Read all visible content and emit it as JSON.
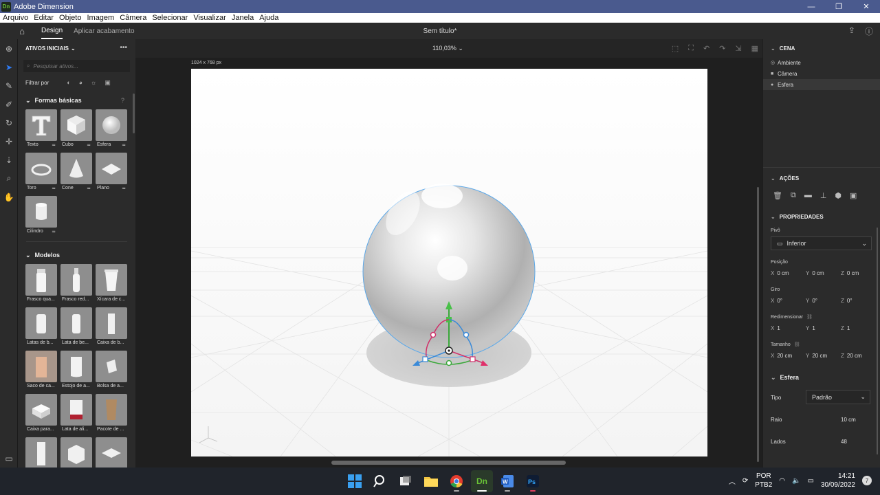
{
  "window": {
    "title": "Adobe Dimension",
    "logo": "Dn",
    "min": "—",
    "max": "❐",
    "close": "✕"
  },
  "menu": [
    "Arquivo",
    "Editar",
    "Objeto",
    "Imagem",
    "Câmera",
    "Selecionar",
    "Visualizar",
    "Janela",
    "Ajuda"
  ],
  "topbar": {
    "tabs": [
      "Design",
      "Aplicar acabamento"
    ],
    "doc_title": "Sem título*"
  },
  "assets": {
    "header": "ATIVOS INICIAIS",
    "search_placeholder": "Pesquisar ativos...",
    "filter_label": "Filtrar por",
    "basic_shapes": {
      "title": "Formas básicas",
      "items": [
        "Texto",
        "Cubo",
        "Esfera",
        "Toro",
        "Cone",
        "Plano",
        "Cilindro"
      ]
    },
    "models": {
      "title": "Modelos",
      "items": [
        "Frasco qua...",
        "Frasco red...",
        "Xícara de c...",
        "Latas de b...",
        "Lata de be...",
        "Caixa de b...",
        "Saco de ca...",
        "Estojo de a...",
        "Bolsa de a...",
        "Caixa para...",
        "Lata de ali...",
        "Pacote de ...",
        "",
        "",
        ""
      ]
    }
  },
  "canvas": {
    "zoom": "110,03%",
    "doc_size": "1024 x 768 px"
  },
  "scene": {
    "title": "CENA",
    "items": [
      "Ambiente",
      "Câmera",
      "Esfera"
    ]
  },
  "actions": {
    "title": "AÇÕES"
  },
  "properties": {
    "title": "PROPRIEDADES",
    "pivot_label": "Pivô",
    "pivot_value": "Inferior",
    "position": {
      "label": "Posição",
      "x": "0 cm",
      "y": "0 cm",
      "z": "0 cm"
    },
    "rotation": {
      "label": "Giro",
      "x": "0°",
      "y": "0°",
      "z": "0°"
    },
    "scale": {
      "label": "Redimensionar",
      "x": "1",
      "y": "1",
      "z": "1"
    },
    "size": {
      "label": "Tamanho",
      "x": "20 cm",
      "y": "20 cm",
      "z": "20 cm"
    }
  },
  "sphere": {
    "title": "Esfera",
    "type_label": "Tipo",
    "type_value": "Padrão",
    "radius_label": "Raio",
    "radius_value": "10 cm",
    "sides_label": "Lados",
    "sides_value": "48"
  },
  "taskbar": {
    "lang1": "POR",
    "lang2": "PTB2",
    "time": "14:21",
    "date": "30/09/2022",
    "notif": "7"
  }
}
